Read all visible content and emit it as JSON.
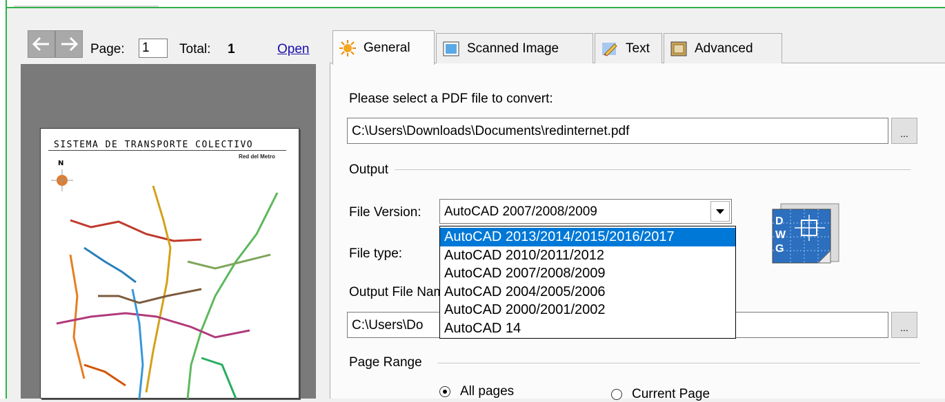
{
  "navigation": {
    "page_label": "Page:",
    "page_value": "1",
    "total_label": "Total:",
    "total_value": "1",
    "open_label": "Open"
  },
  "preview": {
    "map_title": "SISTEMA DE TRANSPORTE COLECTIVO",
    "map_subtitle": "Red del Metro",
    "north_letter": "N"
  },
  "tabs": [
    {
      "label": "General",
      "icon": "sun-icon",
      "active": true
    },
    {
      "label": "Scanned Image",
      "icon": "image-icon",
      "active": false
    },
    {
      "label": "Text",
      "icon": "pencil-icon",
      "active": false
    },
    {
      "label": "Advanced",
      "icon": "frame-icon",
      "active": false
    }
  ],
  "general": {
    "pdf_label": "Please select a PDF file to convert:",
    "pdf_path": "C:\\Users\\Downloads\\Documents\\redinternet.pdf",
    "browse_label": "...",
    "output_group": "Output",
    "file_version_label": "File Version:",
    "file_version_value": "AutoCAD 2007/2008/2009",
    "file_version_options": [
      "AutoCAD 2013/2014/2015/2016/2017",
      "AutoCAD 2010/2011/2012",
      "AutoCAD 2007/2008/2009",
      "AutoCAD 2004/2005/2006",
      "AutoCAD 2000/2001/2002",
      "AutoCAD 14"
    ],
    "file_type_label": "File type:",
    "output_file_name_label": "Output File Name:",
    "output_path": "C:\\Users\\Do",
    "page_range_group": "Page Range",
    "radio_all_pages": "All pages",
    "radio_current_page": "Current Page",
    "dwg_letters": [
      "D",
      "W",
      "G"
    ]
  },
  "colors": {
    "accent": "#0078d7",
    "frame_green": "#2fb24a",
    "link": "#1a0dab"
  }
}
